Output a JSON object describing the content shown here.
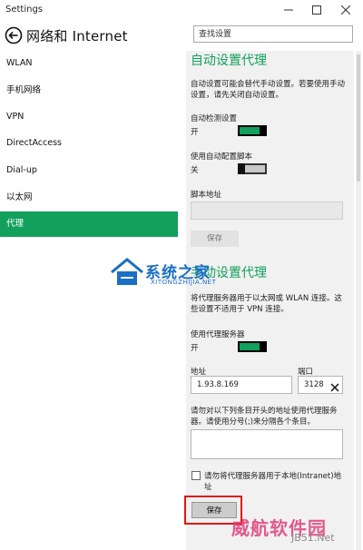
{
  "window": {
    "title": "Settings"
  },
  "header": {
    "title": "网络和 Internet",
    "search_placeholder": "查找设置"
  },
  "sidebar": {
    "items": [
      {
        "label": "WLAN"
      },
      {
        "label": "手机网络"
      },
      {
        "label": "VPN"
      },
      {
        "label": "DirectAccess"
      },
      {
        "label": "Dial-up"
      },
      {
        "label": "以太网"
      },
      {
        "label": "代理",
        "active": true
      }
    ]
  },
  "auto": {
    "heading": "自动设置代理",
    "description": "自动设置可能会替代手动设置。若要使用手动设置，请先关闭自动设置。",
    "detect_label": "自动检测设置",
    "detect_state": "开",
    "script_label": "使用自动配置脚本",
    "script_state": "关",
    "address_label": "脚本地址",
    "save_label": "保存"
  },
  "manual": {
    "heading": "手动设置代理",
    "description": "将代理服务器用于以太网或 WLAN 连接。这些设置不适用于 VPN 连接。",
    "use_proxy_label": "使用代理服务器",
    "use_proxy_state": "开",
    "address_label": "地址",
    "address_value": "1.93.8.169",
    "port_label": "端口",
    "port_value": "3128",
    "exceptions_text": "请勿对以下列条目开头的地址使用代理服务器。请使用分号(;)来分隔各个条目。",
    "local_label": "请勿将代理服务器用于本地(Intranet)地址",
    "save_label": "保存"
  },
  "watermark": {
    "site_cn": "系统之家",
    "site_en": "XITONGZHIJIA.NET",
    "brand2": "威航软件园",
    "brand2_url": "JB51.Net"
  },
  "colors": {
    "accent": "#12a05c",
    "highlight": "#e11717"
  }
}
